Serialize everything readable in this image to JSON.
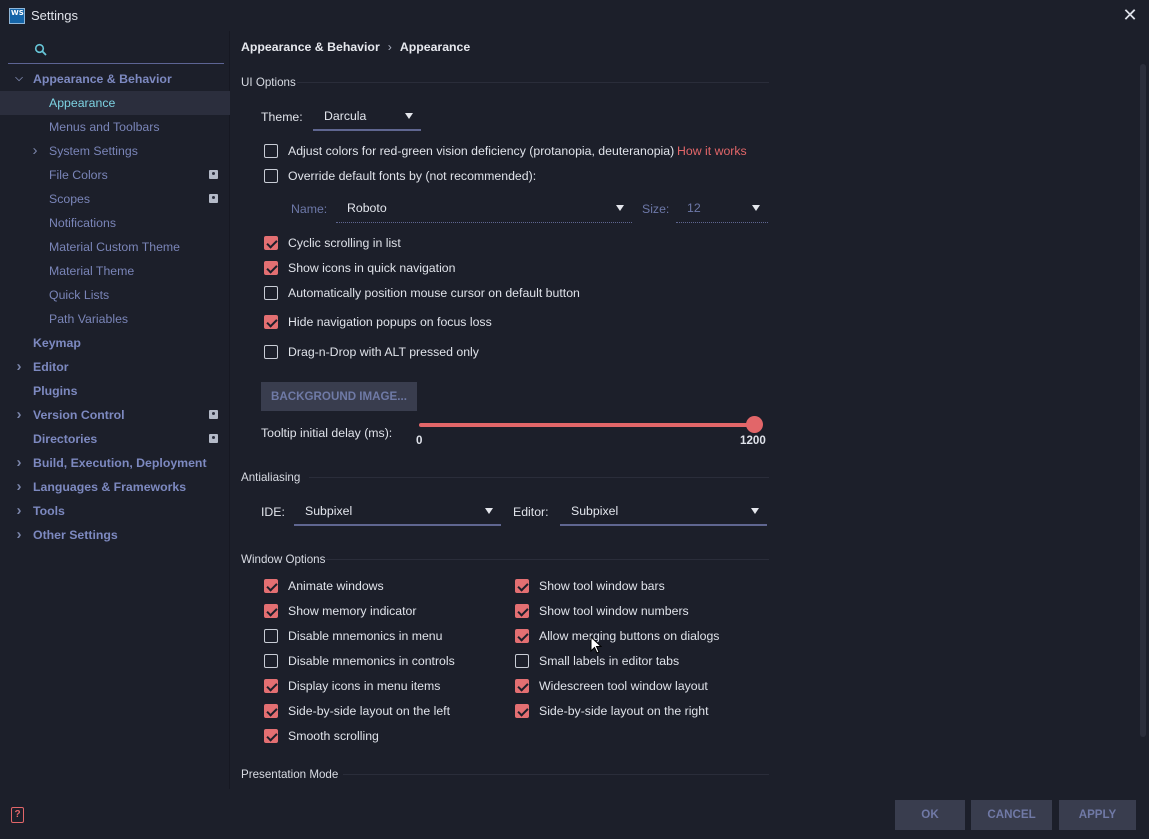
{
  "window": {
    "title": "Settings",
    "logo": "WS",
    "close_glyph": "✕"
  },
  "search": {
    "placeholder": ""
  },
  "sidebar": {
    "items": [
      {
        "label": "Appearance & Behavior",
        "chevron": "expanded",
        "level": 0
      },
      {
        "label": "Appearance",
        "selected": true,
        "level": 1
      },
      {
        "label": "Menus and Toolbars",
        "level": 1
      },
      {
        "label": "System Settings",
        "chevron": "collapsed",
        "level": 1
      },
      {
        "label": "File Colors",
        "project_icon": true,
        "level": 1
      },
      {
        "label": "Scopes",
        "project_icon": true,
        "level": 1
      },
      {
        "label": "Notifications",
        "level": 1
      },
      {
        "label": "Material Custom Theme",
        "level": 1
      },
      {
        "label": "Material Theme",
        "level": 1
      },
      {
        "label": "Quick Lists",
        "level": 1
      },
      {
        "label": "Path Variables",
        "level": 1
      },
      {
        "label": "Keymap",
        "level": 0
      },
      {
        "label": "Editor",
        "chevron": "collapsed",
        "level": 0
      },
      {
        "label": "Plugins",
        "level": 0
      },
      {
        "label": "Version Control",
        "chevron": "collapsed",
        "project_icon": true,
        "level": 0
      },
      {
        "label": "Directories",
        "project_icon": true,
        "level": 0
      },
      {
        "label": "Build, Execution, Deployment",
        "chevron": "collapsed",
        "level": 0
      },
      {
        "label": "Languages & Frameworks",
        "chevron": "collapsed",
        "level": 0
      },
      {
        "label": "Tools",
        "chevron": "collapsed",
        "level": 0
      },
      {
        "label": "Other Settings",
        "chevron": "collapsed",
        "level": 0
      }
    ]
  },
  "breadcrumb": {
    "parent": "Appearance & Behavior",
    "separator": "›",
    "current": "Appearance"
  },
  "ui_options": {
    "title": "UI Options",
    "theme_label": "Theme:",
    "theme_value": "Darcula",
    "adjust_colors": {
      "label": "Adjust colors for red-green vision deficiency (protanopia, deuteranopia)",
      "checked": false
    },
    "how_it_works": "How it works",
    "override_fonts": {
      "label": "Override default fonts by (not recommended):",
      "checked": false
    },
    "font_name_label": "Name:",
    "font_name_value": "Roboto",
    "font_size_label": "Size:",
    "font_size_value": "12",
    "cyclic_scrolling": {
      "label": "Cyclic scrolling in list",
      "checked": true
    },
    "show_icons_quick_nav": {
      "label": "Show icons in quick navigation",
      "checked": true
    },
    "auto_position_mouse": {
      "label": "Automatically position mouse cursor on default button",
      "checked": false
    },
    "hide_nav_popups": {
      "label": "Hide navigation popups on focus loss",
      "checked": true
    },
    "drag_n_drop_alt": {
      "label": "Drag-n-Drop with ALT pressed only",
      "checked": false
    },
    "background_image_button": "BACKGROUND IMAGE...",
    "tooltip_label": "Tooltip initial delay (ms):",
    "tooltip_min": "0",
    "tooltip_max": "1200",
    "tooltip_value_fraction": 1.0
  },
  "antialiasing": {
    "title": "Antialiasing",
    "ide_label": "IDE:",
    "ide_value": "Subpixel",
    "editor_label": "Editor:",
    "editor_value": "Subpixel"
  },
  "window_options": {
    "title": "Window Options",
    "left": [
      {
        "label": "Animate windows",
        "checked": true
      },
      {
        "label": "Show memory indicator",
        "checked": true
      },
      {
        "label": "Disable mnemonics in menu",
        "checked": false
      },
      {
        "label": "Disable mnemonics in controls",
        "checked": false
      },
      {
        "label": "Display icons in menu items",
        "checked": true
      },
      {
        "label": "Side-by-side layout on the left",
        "checked": true
      },
      {
        "label": "Smooth scrolling",
        "checked": true
      }
    ],
    "right": [
      {
        "label": "Show tool window bars",
        "checked": true
      },
      {
        "label": "Show tool window numbers",
        "checked": true
      },
      {
        "label": "Allow merging buttons on dialogs",
        "checked": true
      },
      {
        "label": "Small labels in editor tabs",
        "checked": false
      },
      {
        "label": "Widescreen tool window layout",
        "checked": true
      },
      {
        "label": "Side-by-side layout on the right",
        "checked": true
      }
    ]
  },
  "presentation_mode": {
    "title": "Presentation Mode"
  },
  "footer": {
    "help_glyph": "?",
    "ok": "OK",
    "cancel": "CANCEL",
    "apply": "APPLY"
  },
  "colors": {
    "accent": "#e26669",
    "selected_text": "#7dd2e2",
    "sidebar_text": "#7a85b8",
    "background": "#1c1f2a"
  }
}
